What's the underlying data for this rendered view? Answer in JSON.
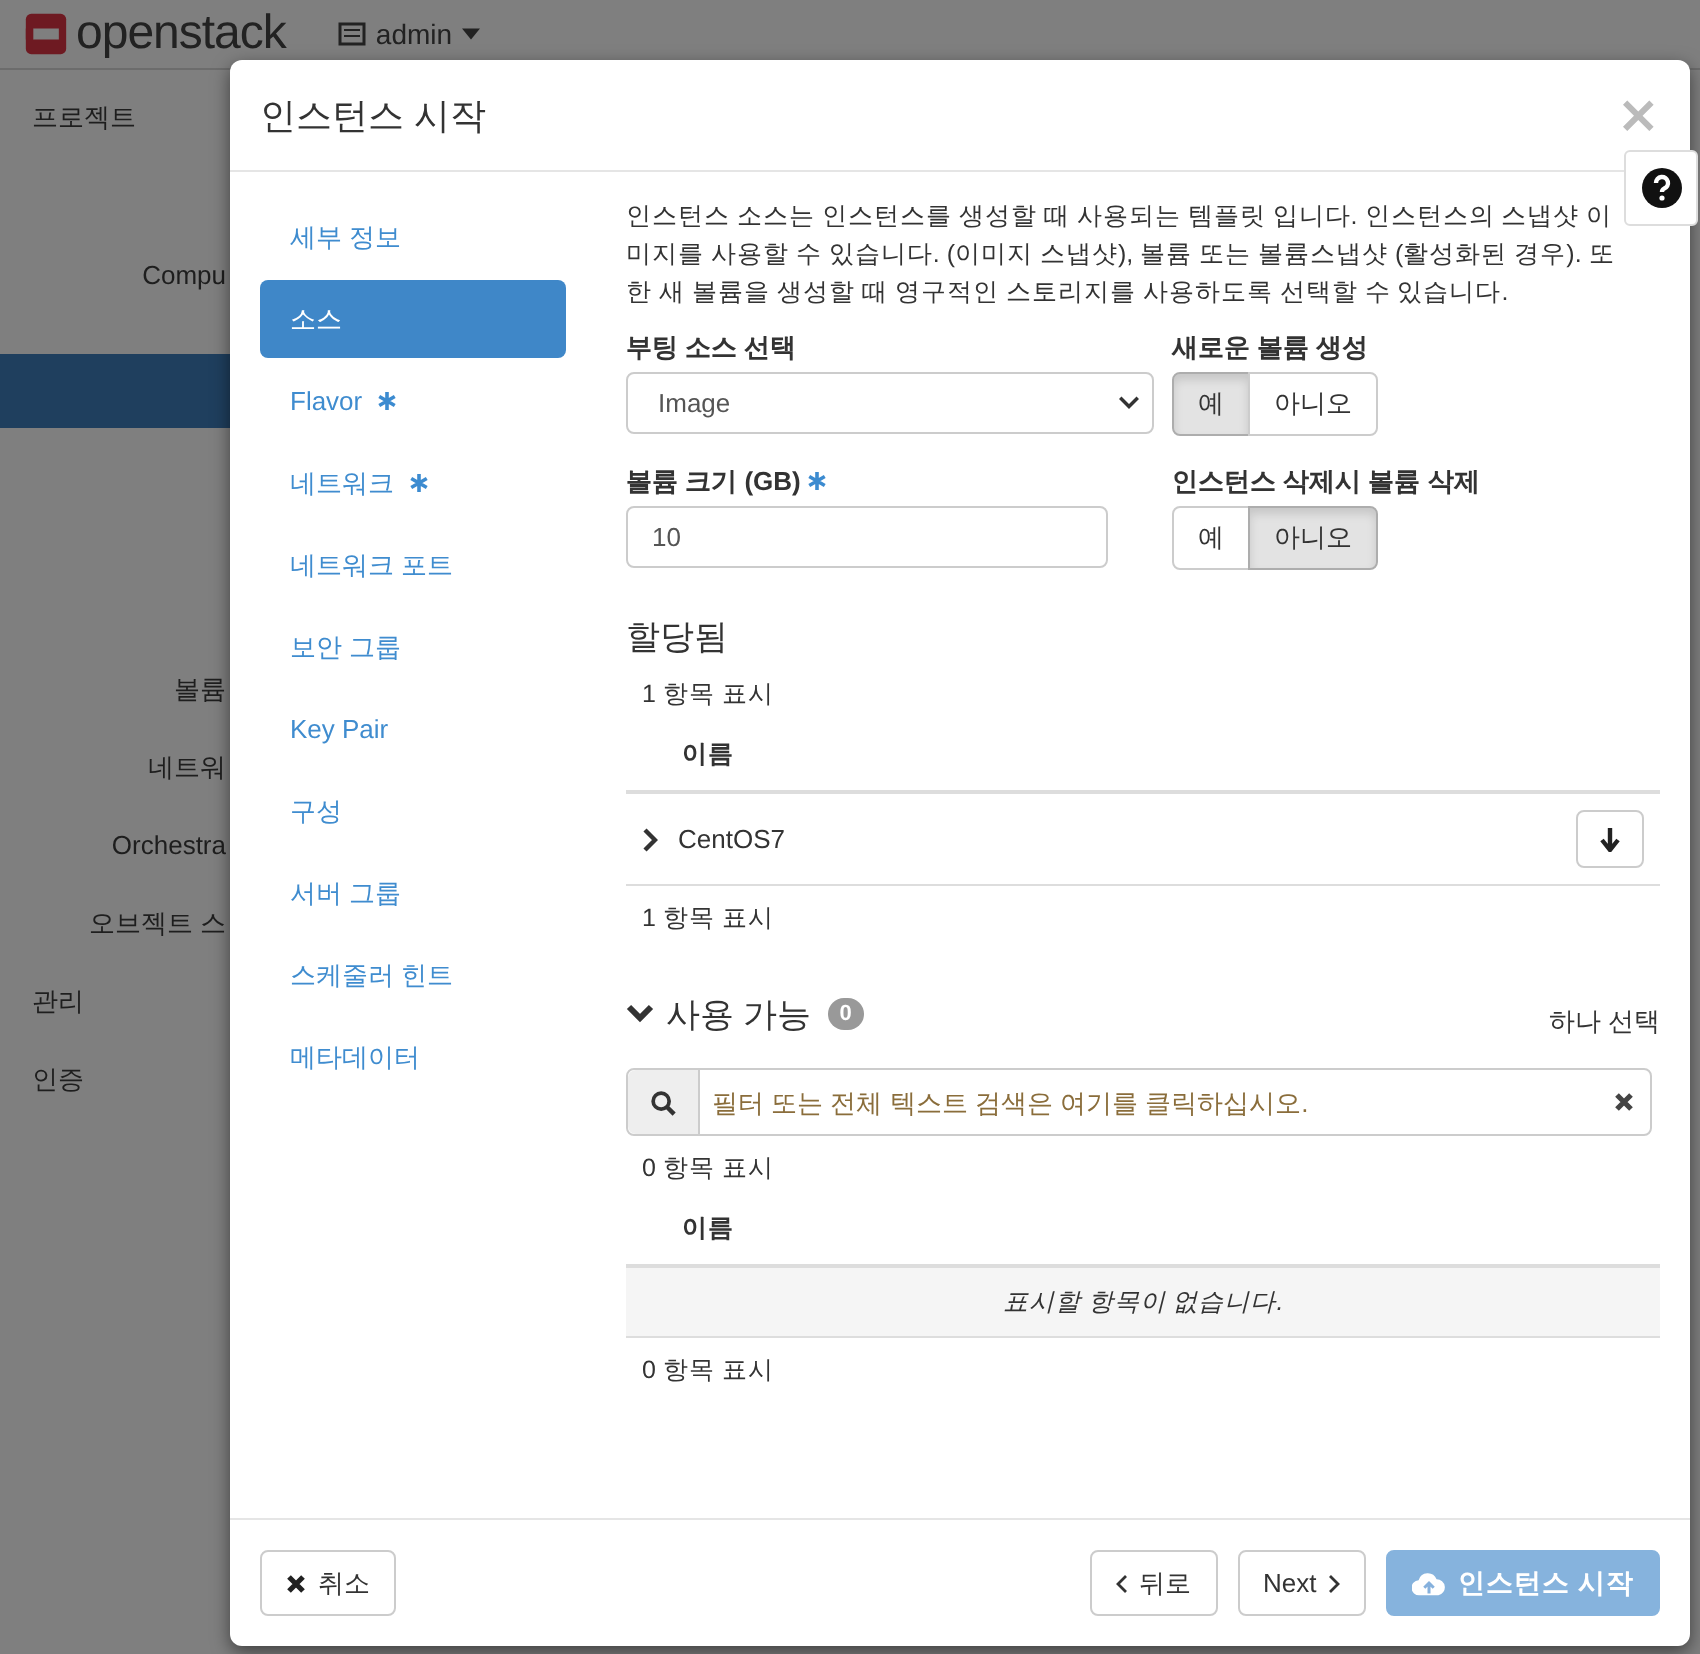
{
  "header": {
    "logo": "openstack",
    "project_menu": "admin"
  },
  "sidebar": {
    "items": [
      {
        "kind": "panel",
        "label": "프로젝트",
        "selected": false
      },
      {
        "kind": "group",
        "label": "Compu",
        "selected": false
      },
      {
        "kind": "blank",
        "selected": true
      },
      {
        "kind": "group",
        "label": "볼륨",
        "selected": false
      },
      {
        "kind": "group",
        "label": "네트워",
        "selected": false
      },
      {
        "kind": "group",
        "label": "Orchestra",
        "selected": false
      },
      {
        "kind": "group",
        "label": "오브젝트 스",
        "selected": false
      },
      {
        "kind": "panel",
        "label": "관리",
        "selected": false
      },
      {
        "kind": "panel",
        "label": "인증",
        "selected": false
      }
    ]
  },
  "modal": {
    "title": "인스턴스 시작",
    "close": "×",
    "steps": [
      {
        "label": "세부 정보",
        "required": false,
        "selected": false
      },
      {
        "label": "소스",
        "required": false,
        "selected": true
      },
      {
        "label": "Flavor",
        "required": true,
        "selected": false
      },
      {
        "label": "네트워크",
        "required": true,
        "selected": false
      },
      {
        "label": "네트워크 포트",
        "required": false,
        "selected": false
      },
      {
        "label": "보안 그룹",
        "required": false,
        "selected": false
      },
      {
        "label": "Key Pair",
        "required": false,
        "selected": false
      },
      {
        "label": "구성",
        "required": false,
        "selected": false
      },
      {
        "label": "서버 그룹",
        "required": false,
        "selected": false
      },
      {
        "label": "스케줄러 힌트",
        "required": false,
        "selected": false
      },
      {
        "label": "메타데이터",
        "required": false,
        "selected": false
      }
    ],
    "description": "인스턴스 소스는 인스턴스를 생성할 때 사용되는 템플릿 입니다. 인스턴스의 스냅샷 이미지를 사용할 수 있습니다. (이미지 스냅샷), 볼륨 또는 볼륨스냅샷 (활성화된 경우). 또한 새 볼륨을 생성할 때 영구적인 스토리지를 사용하도록 선택할 수 있습니다.",
    "boot_source": {
      "label": "부팅 소스 선택",
      "value": "Image"
    },
    "create_volume": {
      "label": "새로운 볼륨 생성",
      "options": [
        {
          "label": "예",
          "selected": true
        },
        {
          "label": "아니오",
          "selected": false
        }
      ]
    },
    "volume_size": {
      "label": "볼륨 크기 (GB)",
      "required": true,
      "value": "10"
    },
    "delete_volume": {
      "label": "인스턴스 삭제시 볼륨 삭제",
      "options": [
        {
          "label": "예",
          "selected": false
        },
        {
          "label": "아니오",
          "selected": true
        }
      ]
    },
    "allocated": {
      "title": "할당됨",
      "count_top": "1 항목 표시",
      "column": "이름",
      "rows": [
        {
          "name": "CentOS7",
          "expanded": false
        }
      ],
      "count_bottom": "1 항목 표시"
    },
    "available": {
      "title": "사용 가능",
      "expanded": true,
      "badge": "0",
      "select_hint": "하나 선택",
      "search_placeholder": "필터 또는 전체 텍스트 검색은 여기를 클릭하십시오.",
      "count_top": "0 항목 표시",
      "column": "이름",
      "empty": "표시할 항목이 없습니다.",
      "count_bottom": "0 항목 표시"
    },
    "footer": {
      "cancel": "취소",
      "back": "뒤로",
      "next": "Next",
      "launch": {
        "label": "인스턴스 시작",
        "disabled": true
      }
    }
  }
}
